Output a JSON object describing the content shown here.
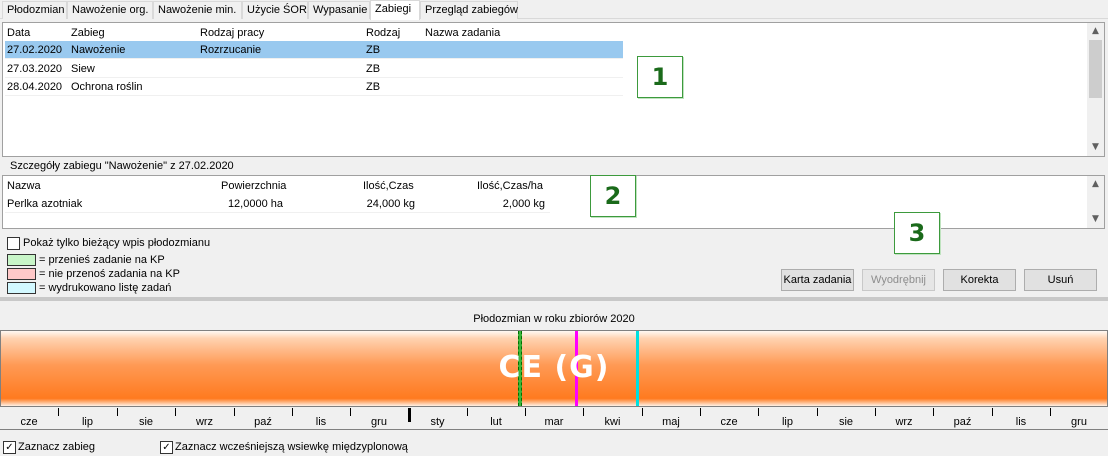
{
  "tabs": [
    "Płodozmian",
    "Nawożenie org.",
    "Nawożenie min.",
    "Użycie ŚOR",
    "Wypasanie",
    "Zabiegi",
    "Przegląd zabiegów"
  ],
  "active_tab": "Zabiegi",
  "treatments": {
    "columns": [
      "Data",
      "Zabieg",
      "Rodzaj pracy",
      "Rodzaj",
      "Nazwa zadania"
    ],
    "rows": [
      {
        "date": "27.02.2020",
        "zabieg": "Nawożenie",
        "rodzaj_pracy": "Rozrzucanie",
        "rodzaj": "ZB",
        "nazwa": ""
      },
      {
        "date": "27.03.2020",
        "zabieg": "Siew",
        "rodzaj_pracy": "",
        "rodzaj": "ZB",
        "nazwa": ""
      },
      {
        "date": "28.04.2020",
        "zabieg": "Ochrona roślin",
        "rodzaj_pracy": "",
        "rodzaj": "ZB",
        "nazwa": ""
      }
    ]
  },
  "details": {
    "title": "Szczegóły zabiegu \"Nawożenie\" z 27.02.2020",
    "columns": [
      "Nazwa",
      "Powierzchnia",
      "Ilość,Czas",
      "Ilość,Czas/ha"
    ],
    "rows": [
      {
        "nazwa": "Perlka azotniak",
        "powierzchnia": "12,0000 ha",
        "ilosc": "24,000 kg",
        "ilosc_ha": "2,000 kg"
      }
    ]
  },
  "callouts": [
    "1",
    "2",
    "3"
  ],
  "options": {
    "current_only_label": "Pokaż tylko bieżący wpis płodozmianu",
    "current_only_checked": false
  },
  "legend": [
    {
      "color": "#c8f5c8",
      "label": "= przenieś zadanie na KP"
    },
    {
      "color": "#ffc8c8",
      "label": "= nie przenoś zadania na KP"
    },
    {
      "color": "#d2f8ff",
      "label": "= wydrukowano listę zadań"
    }
  ],
  "buttons": {
    "karta": "Karta zadania",
    "wyodrebnij": "Wyodrębnij",
    "korekta": "Korekta",
    "usun": "Usuń"
  },
  "rotation": {
    "title": "Płodozmian w roku zbiorów 2020",
    "crop_label": "CE (G)",
    "months": [
      "cze",
      "lip",
      "sie",
      "wrz",
      "paź",
      "lis",
      "gru",
      "sty",
      "lut",
      "mar",
      "kwi",
      "maj",
      "cze",
      "lip",
      "sie",
      "wrz",
      "paź",
      "lis",
      "gru"
    ],
    "markers": [
      {
        "type": "dashed",
        "color": "#00a000"
      },
      {
        "type": "solid",
        "color": "#ff00ff"
      },
      {
        "type": "solid",
        "color": "#00e0e0"
      }
    ]
  },
  "bottom_checks": {
    "zaznacz_zabieg": "Zaznacz zabieg",
    "zaznacz_zabieg_checked": true,
    "zaznacz_wsiewke": "Zaznacz wcześniejszą wsiewkę międzyplonową",
    "zaznacz_wsiewke_checked": true
  },
  "colors": {
    "selection": "#99c9ef",
    "callout_border": "#3d9a3d",
    "crop_bar": "#ff8a33"
  }
}
